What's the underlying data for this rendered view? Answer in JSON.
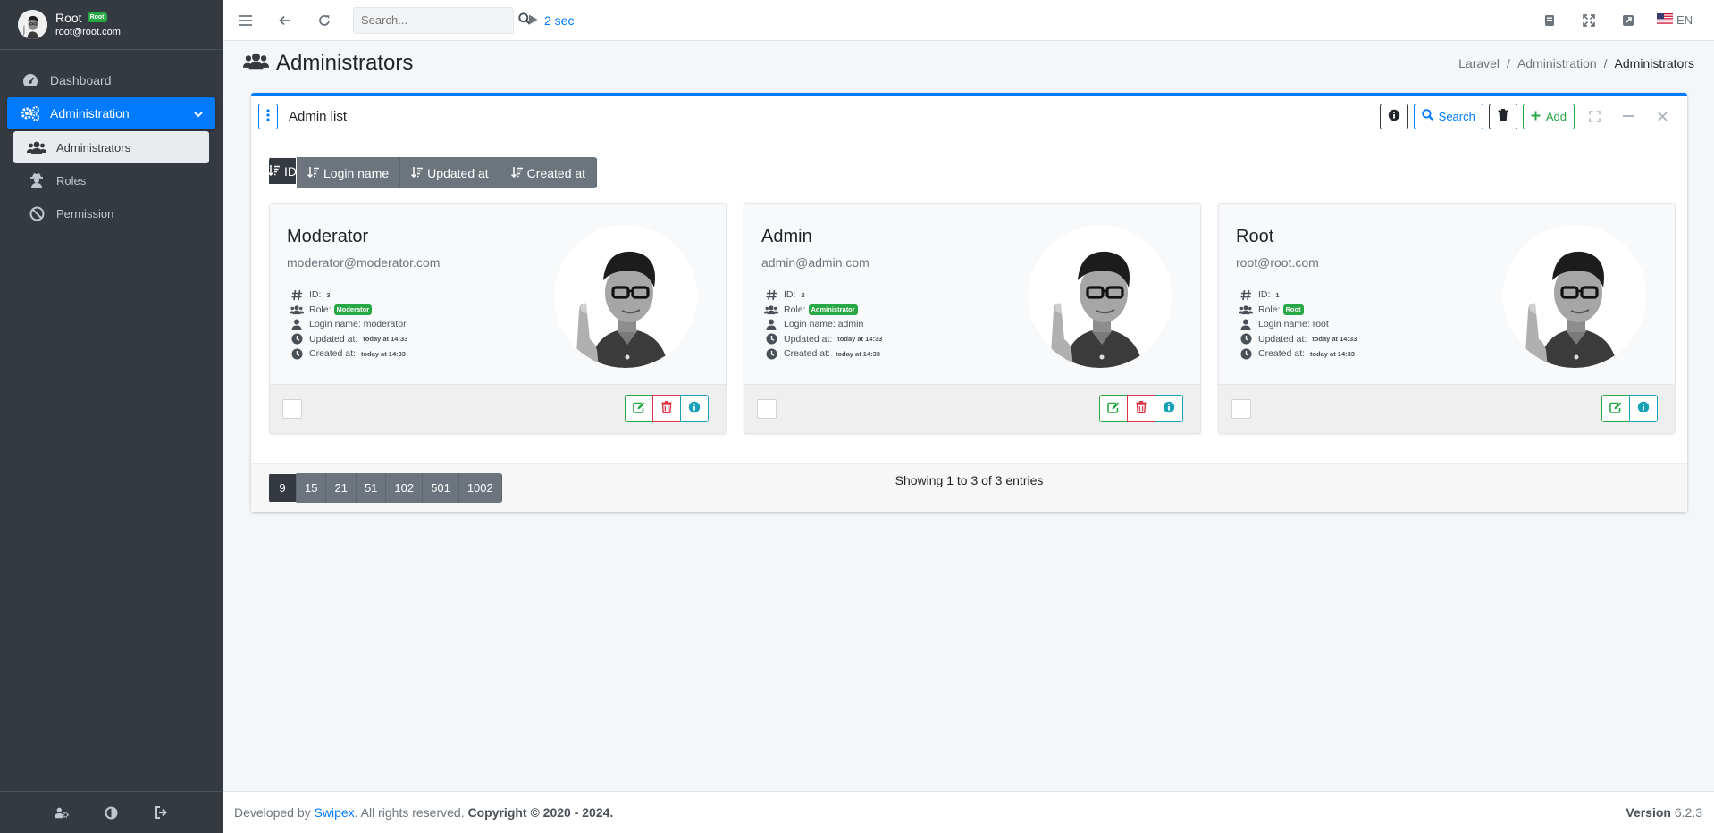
{
  "user": {
    "name": "Root",
    "role_badge": "Root",
    "email": "root@root.com"
  },
  "sidebar": {
    "items": [
      {
        "label": "Dashboard",
        "icon": "dashboard-icon"
      },
      {
        "label": "Administration",
        "icon": "cogs-icon",
        "active": true
      },
      {
        "label": "Administrators",
        "icon": "users-icon",
        "sub": true,
        "selected": true
      },
      {
        "label": "Roles",
        "icon": "user-secret-icon",
        "sub": true
      },
      {
        "label": "Permission",
        "icon": "ban-icon",
        "sub": true
      }
    ]
  },
  "topbar": {
    "search_placeholder": "Search...",
    "timer": "2 sec",
    "lang": "EN"
  },
  "header": {
    "title": "Administrators",
    "breadcrumb": [
      "Laravel",
      "Administration",
      "Administrators"
    ]
  },
  "card": {
    "title": "Admin list",
    "search_label": "Search",
    "add_label": "Add",
    "sort_buttons": [
      "ID",
      "Login name",
      "Updated at",
      "Created at"
    ],
    "field_labels": {
      "id": "ID:",
      "role": "Role:",
      "login": "Login name:",
      "updated": "Updated at:",
      "created": "Created at:"
    },
    "profiles": [
      {
        "name": "Moderator",
        "email": "moderator@moderator.com",
        "id": "3",
        "role": "Moderator",
        "login": "moderator",
        "updated": "today at 14:33",
        "created": "today at 14:33",
        "can_delete": true
      },
      {
        "name": "Admin",
        "email": "admin@admin.com",
        "id": "2",
        "role": "Administrator",
        "login": "admin",
        "updated": "today at 14:33",
        "created": "today at 14:33",
        "can_delete": true
      },
      {
        "name": "Root",
        "email": "root@root.com",
        "id": "1",
        "role": "Root",
        "login": "root",
        "updated": "today at 14:33",
        "created": "today at 14:33",
        "can_delete": false
      }
    ],
    "per_page": [
      "9",
      "15",
      "21",
      "51",
      "102",
      "501",
      "1002"
    ],
    "showing": "Showing 1 to 3 of 3 entries"
  },
  "footer": {
    "developed_by": "Developed by ",
    "company": "Swipex",
    "rights": ". All rights reserved. ",
    "copyright": "Copyright © 2020 - 2024.",
    "version_label": "Version",
    "version": "6.2.3"
  },
  "colors": {
    "primary": "#007bff",
    "success": "#28a745",
    "danger": "#dc3545",
    "info": "#17a2b8",
    "sidebar": "#343a40"
  }
}
